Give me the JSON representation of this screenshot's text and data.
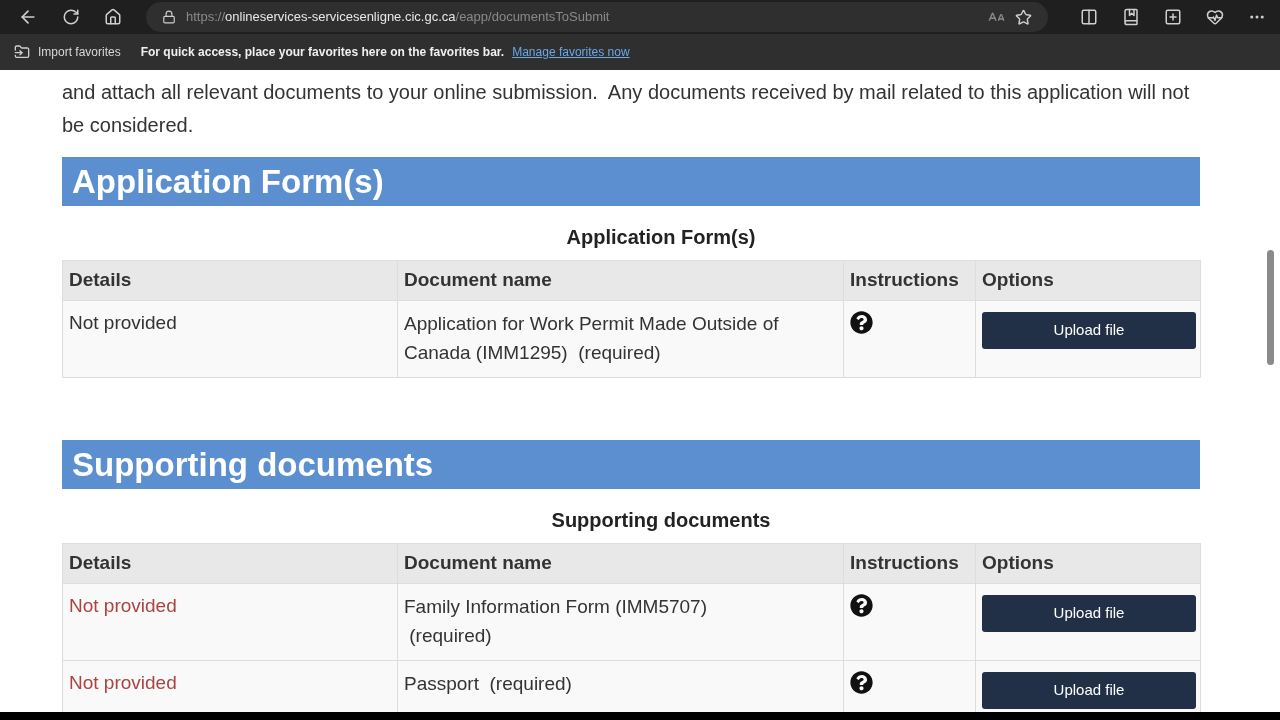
{
  "browser": {
    "url_scheme": "https://",
    "url_host": "onlineservices-servicesenligne.cic.gc.ca",
    "url_path": "/eapp/documentsToSubmit",
    "favorites_bar": {
      "import": "Import favorites",
      "message": "For quick access, place your favorites here on the favorites bar.",
      "link": "Manage favorites now"
    }
  },
  "intro": "and attach all relevant documents to your online submission.  Any documents received by mail related to this application will not be considered.",
  "sections": [
    {
      "heading": "Application Form(s)",
      "table": {
        "caption": "Application Form(s)",
        "columns": [
          "Details",
          "Document name",
          "Instructions",
          "Options"
        ],
        "rows": [
          {
            "details": "Not provided",
            "missing": false,
            "document_name": "Application for Work Permit Made Outside of Canada (IMM1295)  (required)",
            "button": "Upload file"
          }
        ]
      }
    },
    {
      "heading": "Supporting documents",
      "table": {
        "caption": "Supporting documents",
        "columns": [
          "Details",
          "Document name",
          "Instructions",
          "Options"
        ],
        "rows": [
          {
            "details": "Not provided",
            "missing": true,
            "document_name": "Family Information Form (IMM5707)\n (required)",
            "button": "Upload file"
          },
          {
            "details": "Not provided",
            "missing": true,
            "document_name": "Passport  (required)",
            "button": "Upload file"
          }
        ]
      }
    }
  ]
}
